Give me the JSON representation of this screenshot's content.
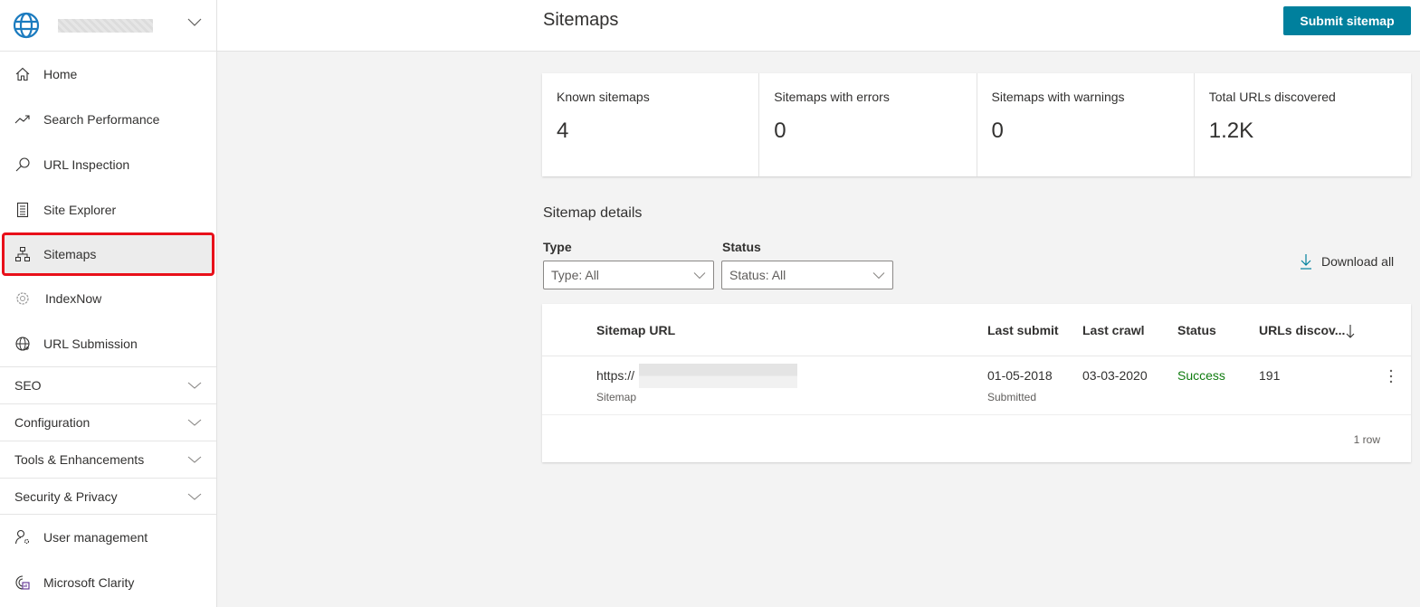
{
  "sidebar": {
    "site_name": "",
    "items": [
      {
        "label": "Home",
        "icon": "home-icon"
      },
      {
        "label": "Search Performance",
        "icon": "trend-icon"
      },
      {
        "label": "URL Inspection",
        "icon": "search-icon"
      },
      {
        "label": "Site Explorer",
        "icon": "checklist-icon"
      },
      {
        "label": "Sitemaps",
        "icon": "sitemap-icon",
        "active": true
      },
      {
        "label": "IndexNow",
        "icon": "gear-icon"
      },
      {
        "label": "URL Submission",
        "icon": "globe-add-icon"
      }
    ],
    "groups": [
      {
        "label": "SEO"
      },
      {
        "label": "Configuration"
      },
      {
        "label": "Tools & Enhancements"
      },
      {
        "label": "Security & Privacy"
      }
    ],
    "bottom_items": [
      {
        "label": "User management",
        "icon": "user-settings-icon"
      },
      {
        "label": "Microsoft Clarity",
        "icon": "clarity-icon"
      }
    ]
  },
  "header": {
    "title": "Sitemaps",
    "submit_label": "Submit sitemap"
  },
  "summary": [
    {
      "label": "Known sitemaps",
      "value": "4"
    },
    {
      "label": "Sitemaps with errors",
      "value": "0"
    },
    {
      "label": "Sitemaps with warnings",
      "value": "0"
    },
    {
      "label": "Total URLs discovered",
      "value": "1.2K"
    }
  ],
  "details": {
    "title": "Sitemap details",
    "filters": {
      "type_label": "Type",
      "type_value": "Type: All",
      "status_label": "Status",
      "status_value": "Status: All"
    },
    "download_all_label": "Download all",
    "table": {
      "columns": [
        "Sitemap URL",
        "Last submit",
        "Last crawl",
        "Status",
        "URLs discov..."
      ],
      "rows": [
        {
          "url": "https://",
          "type": "Sitemap",
          "last_submit": "01-05-2018",
          "last_submit_sub": "Submitted",
          "last_crawl": "03-03-2020",
          "status": "Success",
          "urls_discovered": "191"
        }
      ],
      "row_count": "1 row"
    }
  },
  "colors": {
    "accent": "#00809d",
    "success": "#107c10",
    "highlight": "#e8101a"
  }
}
